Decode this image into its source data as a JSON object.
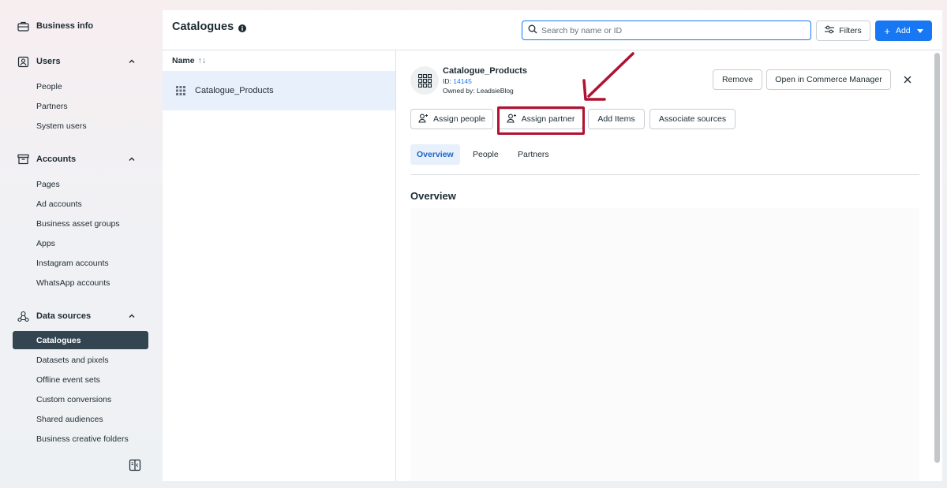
{
  "sidebar": {
    "business_info": "Business info",
    "sections": [
      {
        "label": "Users",
        "items": [
          "People",
          "Partners",
          "System users"
        ]
      },
      {
        "label": "Accounts",
        "items": [
          "Pages",
          "Ad accounts",
          "Business asset groups",
          "Apps",
          "Instagram accounts",
          "WhatsApp accounts"
        ]
      },
      {
        "label": "Data sources",
        "items": [
          "Catalogues",
          "Datasets and pixels",
          "Offline event sets",
          "Custom conversions",
          "Shared audiences",
          "Business creative folders"
        ]
      }
    ],
    "active_item": "Catalogues"
  },
  "header": {
    "title": "Catalogues",
    "search_placeholder": "Search by name or ID",
    "filters_label": "Filters",
    "add_label": "Add"
  },
  "list": {
    "column_header": "Name",
    "sort_icon": "↑↓",
    "rows": [
      "Catalogue_Products"
    ]
  },
  "detail": {
    "name": "Catalogue_Products",
    "id_label": "ID:",
    "id_value": "14145",
    "owner": "Owned by: LeadsieBlog",
    "remove_label": "Remove",
    "open_label": "Open in Commerce Manager",
    "actions": {
      "assign_people": "Assign people",
      "assign_partner": "Assign partner",
      "add_items": "Add Items",
      "associate_sources": "Associate sources"
    },
    "tabs": [
      "Overview",
      "People",
      "Partners"
    ],
    "section_title": "Overview"
  },
  "colors": {
    "accent": "#1877f2",
    "active_nav": "#344552",
    "highlight": "#b11232"
  }
}
